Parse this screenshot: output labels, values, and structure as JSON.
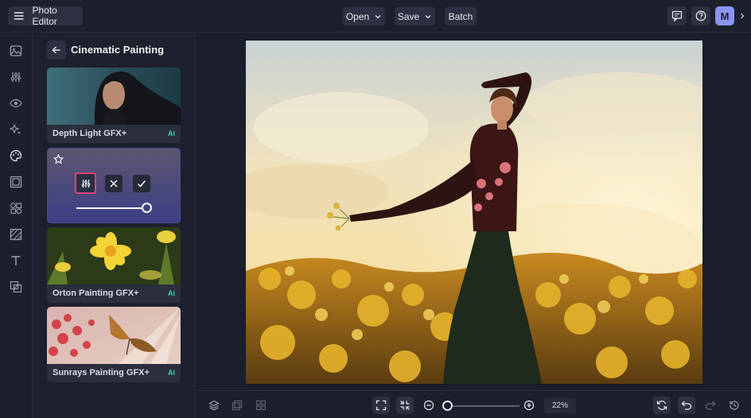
{
  "app": {
    "title": "Photo Editor",
    "avatar_initial": "M",
    "accent": "#e5417a",
    "avatar_color": "#8a95f0"
  },
  "toolbar": {
    "open_label": "Open",
    "save_label": "Save",
    "batch_label": "Batch"
  },
  "rail": {
    "icons": [
      "image-icon",
      "adjust-sliders-icon",
      "eye-icon",
      "sparkle-effects-icon",
      "palette-icon",
      "frame-icon",
      "shapes-icon",
      "texture-icon",
      "text-icon",
      "overlay-icon"
    ]
  },
  "panel": {
    "title": "Cinematic Painting",
    "cards": [
      {
        "label": "Depth Light GFX+",
        "badge": "Ai"
      },
      {
        "label": "Orton Painting GFX+",
        "badge": "Ai"
      },
      {
        "label": "Sunrays Painting GFX+",
        "badge": "Ai"
      }
    ],
    "active_slider_fraction": 1.0
  },
  "bottom": {
    "zoom_label": "22%",
    "zoom_slider_fraction": 0.0
  }
}
